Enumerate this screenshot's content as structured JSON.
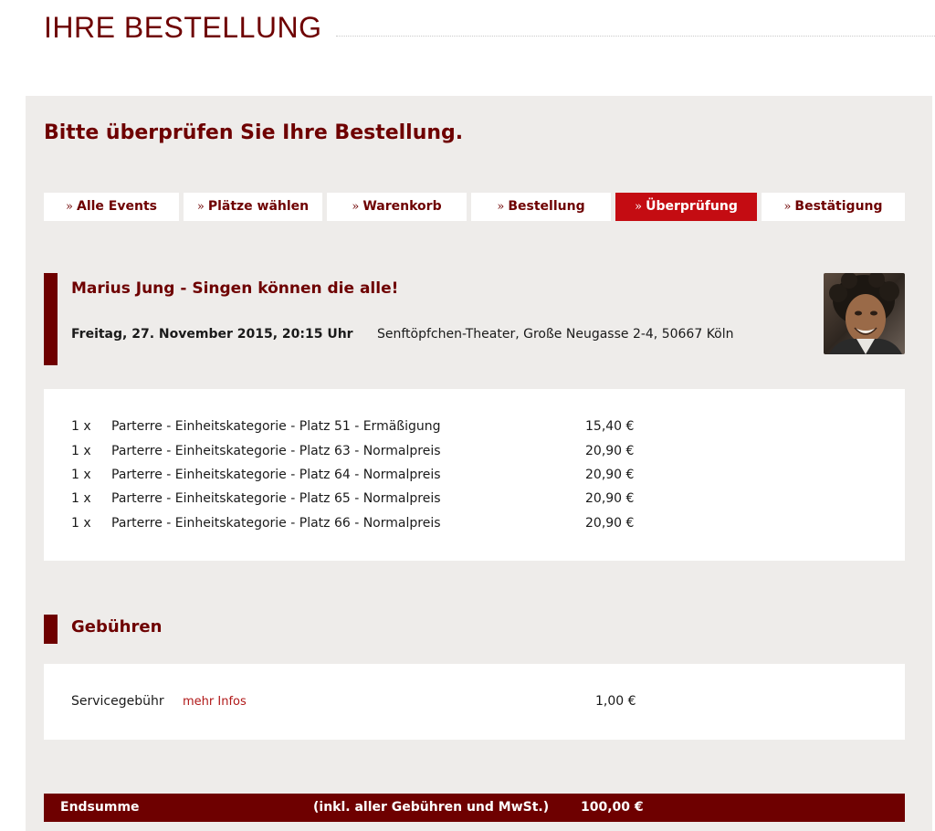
{
  "header": {
    "title": "IHRE BESTELLUNG"
  },
  "panel": {
    "heading": "Bitte überprüfen Sie Ihre Bestellung."
  },
  "steps": [
    {
      "prefix": "»",
      "label": "Alle Events",
      "active": false
    },
    {
      "prefix": "»",
      "label": "Plätze wählen",
      "active": false
    },
    {
      "prefix": "»",
      "label": "Warenkorb",
      "active": false
    },
    {
      "prefix": "»",
      "label": "Bestellung",
      "active": false
    },
    {
      "prefix": "»",
      "label": "Überprüfung",
      "active": true
    },
    {
      "prefix": "»",
      "label": "Bestätigung",
      "active": false
    }
  ],
  "event": {
    "title": "Marius Jung - Singen können die alle!",
    "date": "Freitag, 27. November 2015, 20:15 Uhr",
    "venue": "Senftöpfchen-Theater, Große Neugasse 2-4, 50667 Köln"
  },
  "tickets": [
    {
      "qty": "1 x",
      "desc": "Parterre - Einheitskategorie - Platz 51 - Ermäßigung",
      "price": "15,40 €"
    },
    {
      "qty": "1 x",
      "desc": "Parterre - Einheitskategorie - Platz 63 - Normalpreis",
      "price": "20,90 €"
    },
    {
      "qty": "1 x",
      "desc": "Parterre - Einheitskategorie - Platz 64 - Normalpreis",
      "price": "20,90 €"
    },
    {
      "qty": "1 x",
      "desc": "Parterre - Einheitskategorie - Platz 65 - Normalpreis",
      "price": "20,90 €"
    },
    {
      "qty": "1 x",
      "desc": "Parterre - Einheitskategorie - Platz 66 - Normalpreis",
      "price": "20,90 €"
    }
  ],
  "fees": {
    "heading": "Gebühren",
    "label": "Servicegebühr",
    "link": "mehr Infos",
    "price": "1,00 €"
  },
  "total": {
    "label": "Endsumme",
    "note": "(inkl. aller Gebühren und MwSt.)",
    "amount": "100,00 €"
  },
  "colors": {
    "brand": "#6e0000",
    "active_step": "#c40c12",
    "panel_bg": "#eeecea"
  }
}
